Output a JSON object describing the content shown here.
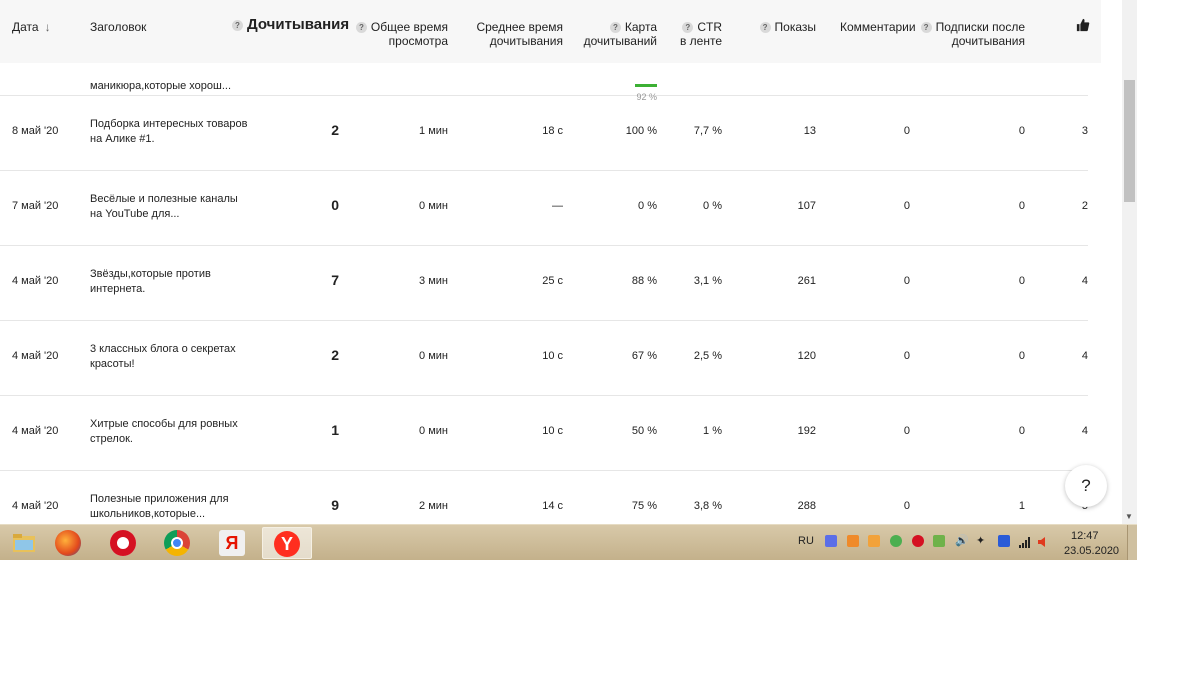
{
  "columns": {
    "date": "Дата",
    "title": "Заголовок",
    "reads": "Дочитывания",
    "total_time_1": "Общее время",
    "total_time_2": "просмотра",
    "avg_time_1": "Среднее время",
    "avg_time_2": "дочитывания",
    "map_1": "Карта",
    "map_2": "дочитываний",
    "ctr_1": "CTR",
    "ctr_2": "в ленте",
    "views": "Показы",
    "comments": "Комментарии",
    "subs_1": "Подписки после",
    "subs_2": "дочитывания",
    "help_mark": "?"
  },
  "partial_row": {
    "title": "маникюра,которые хорош...",
    "map_percent": "92 %",
    "map_fraction": 0.92
  },
  "rows": [
    {
      "date": "8 май '20",
      "title": "Подборка интересных товаров на Алике #1.",
      "reads": "2",
      "total_time": "1 мин",
      "avg_time": "18 с",
      "map": "100 %",
      "ctr": "7,7 %",
      "views": "13",
      "comments": "0",
      "subs": "0",
      "likes": "3"
    },
    {
      "date": "7 май '20",
      "title": "Весёлые и полезные каналы на YouTube для...",
      "reads": "0",
      "total_time": "0 мин",
      "avg_time": "—",
      "map": "0 %",
      "ctr": "0 %",
      "views": "107",
      "comments": "0",
      "subs": "0",
      "likes": "2"
    },
    {
      "date": "4 май '20",
      "title": "Звёзды,которые против интернета.",
      "reads": "7",
      "total_time": "3 мин",
      "avg_time": "25 с",
      "map": "88 %",
      "ctr": "3,1 %",
      "views": "261",
      "comments": "0",
      "subs": "0",
      "likes": "4"
    },
    {
      "date": "4 май '20",
      "title": "3 классных блога о секретах красоты!",
      "reads": "2",
      "total_time": "0 мин",
      "avg_time": "10 с",
      "map": "67 %",
      "ctr": "2,5 %",
      "views": "120",
      "comments": "0",
      "subs": "0",
      "likes": "4"
    },
    {
      "date": "4 май '20",
      "title": "Хитрые способы для ровных стрелок.",
      "reads": "1",
      "total_time": "0 мин",
      "avg_time": "10 с",
      "map": "50 %",
      "ctr": "1 %",
      "views": "192",
      "comments": "0",
      "subs": "0",
      "likes": "4"
    },
    {
      "date": "4 май '20",
      "title": "Полезные приложения для школьников,которые...",
      "reads": "9",
      "total_time": "2 мин",
      "avg_time": "14 с",
      "map": "75 %",
      "ctr": "3,8 %",
      "views": "288",
      "comments": "0",
      "subs": "1",
      "likes": "5"
    }
  ],
  "help_button": "?",
  "taskbar": {
    "apps": [
      "file-explorer-icon",
      "firefox-icon",
      "opera-icon",
      "chrome-icon",
      "yandex-search-icon",
      "yandex-browser-icon"
    ],
    "language": "RU",
    "time": "12:47",
    "date": "23.05.2020"
  },
  "colors": {
    "accent_green": "#3cb034",
    "header_bg": "#f7f7f7",
    "taskbar": "#c9b791"
  }
}
